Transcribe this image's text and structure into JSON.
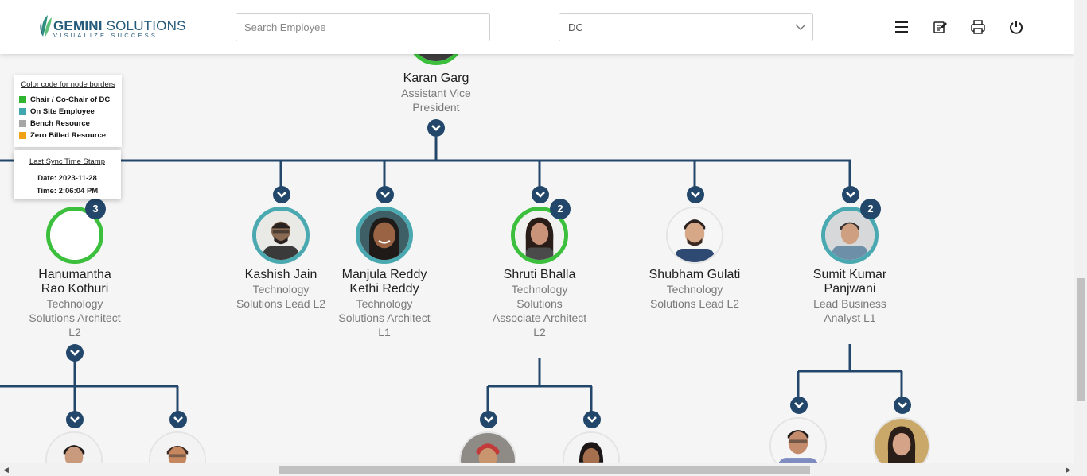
{
  "header": {
    "logo": {
      "brand_bold": "GEMINI",
      "brand_rest": " SOLUTIONS",
      "tagline": "VISUALIZE SUCCESS"
    },
    "search": {
      "placeholder": "Search Employee",
      "value": ""
    },
    "department_select": {
      "value": "DC"
    },
    "icons": [
      "menu-icon",
      "notes-icon",
      "print-icon",
      "power-icon"
    ]
  },
  "legend": {
    "title": "Color code for node borders",
    "items": [
      {
        "label": "Chair / Co-Chair of DC",
        "color": "#2fb52f"
      },
      {
        "label": "On Site Employee",
        "color": "#3fa7ad"
      },
      {
        "label": "Bench Resource",
        "color": "#a6a6a6"
      },
      {
        "label": "Zero Billed Resource",
        "color": "#f0a116"
      }
    ]
  },
  "sync": {
    "title": "Last Sync Time Stamp",
    "date": "Date: 2023-11-28",
    "time": "Time: 2:06:04 PM"
  },
  "tree": {
    "root": {
      "name": "Karan Garg",
      "title_line1": "Assistant Vice",
      "title_line2": "President",
      "border": "green"
    },
    "children": [
      {
        "name_line1": "Hanumantha",
        "name_line2": "Rao Kothuri",
        "title_line1": "Technology",
        "title_line2": "Solutions Architect",
        "title_line3": "L2",
        "badge": "3",
        "border": "green"
      },
      {
        "name_line1": "Kashish Jain",
        "title_line1": "Technology",
        "title_line2": "Solutions Lead L2",
        "border": "teal"
      },
      {
        "name_line1": "Manjula Reddy",
        "name_line2": "Kethi Reddy",
        "title_line1": "Technology",
        "title_line2": "Solutions Architect",
        "title_line3": "L1",
        "border": "teal"
      },
      {
        "name_line1": "Shruti Bhalla",
        "title_line1": "Technology",
        "title_line2": "Solutions",
        "title_line3": "Associate Architect",
        "title_line4": "L2",
        "badge": "2",
        "border": "green"
      },
      {
        "name_line1": "Shubham Gulati",
        "title_line1": "Technology",
        "title_line2": "Solutions Lead L2",
        "border": "plain"
      },
      {
        "name_line1": "Sumit Kumar",
        "name_line2": "Panjwani",
        "title_line1": "Lead Business",
        "title_line2": "Analyst L1",
        "badge": "2",
        "border": "teal"
      }
    ]
  }
}
